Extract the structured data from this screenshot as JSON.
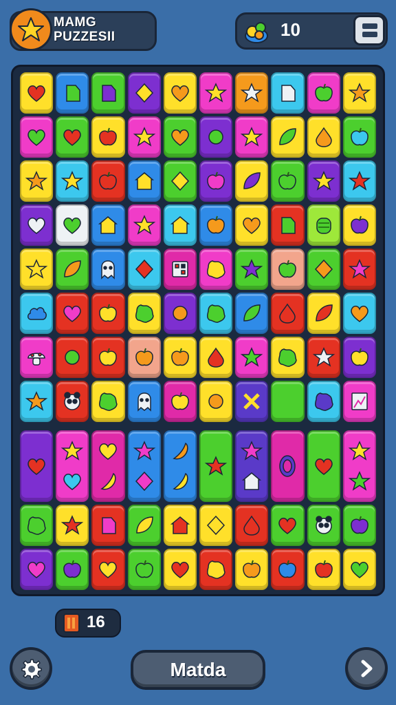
{
  "header": {
    "title": "MAMG PUZZESII",
    "score": "10",
    "title_icon": "star-icon",
    "score_icon": "gem-pile-icon",
    "menu_icon": "menu-icon"
  },
  "footer": {
    "moves": "16",
    "moves_icon": "door-icon",
    "settings_icon": "gear-icon",
    "match_label": "Matda",
    "next_icon": "chevron-right-icon"
  },
  "colors": {
    "background": "#3a6ea8",
    "board": "#1b2a40",
    "yellow": "#ffe02a",
    "blue": "#2f8be8",
    "green": "#4ccf2e",
    "purple": "#7d2fd0",
    "pink": "#f03cc8",
    "orange": "#f59a1c",
    "cyan": "#3cc8ee",
    "red": "#e43222",
    "lime": "#9ee83a",
    "magenta": "#e02aa8",
    "white": "#eef2f5",
    "peach": "#f2a58c",
    "violet": "#5a3ac8"
  },
  "board": {
    "rows": [
      [
        {
          "c": "yellow",
          "s": "heart",
          "f": "red"
        },
        {
          "c": "blue",
          "s": "tag",
          "f": "green"
        },
        {
          "c": "green",
          "s": "tag",
          "f": "purple"
        },
        {
          "c": "purple",
          "s": "diamond",
          "f": "yellow"
        },
        {
          "c": "yellow",
          "s": "heart",
          "f": "orange"
        },
        {
          "c": "pink",
          "s": "star",
          "f": "yellow"
        },
        {
          "c": "orange",
          "s": "star",
          "f": "white"
        },
        {
          "c": "cyan",
          "s": "tag",
          "f": "white"
        },
        {
          "c": "pink",
          "s": "apple",
          "f": "green"
        },
        {
          "c": "yellow",
          "s": "star",
          "f": "orange"
        }
      ],
      [
        {
          "c": "pink",
          "s": "heart",
          "f": "green"
        },
        {
          "c": "green",
          "s": "heart",
          "f": "red"
        },
        {
          "c": "yellow",
          "s": "apple",
          "f": "red"
        },
        {
          "c": "pink",
          "s": "star",
          "f": "yellow"
        },
        {
          "c": "green",
          "s": "heart",
          "f": "orange"
        },
        {
          "c": "purple",
          "s": "circle",
          "f": "green"
        },
        {
          "c": "pink",
          "s": "star",
          "f": "yellow"
        },
        {
          "c": "yellow",
          "s": "leaf",
          "f": "green"
        },
        {
          "c": "yellow",
          "s": "drop",
          "f": "orange"
        },
        {
          "c": "green",
          "s": "apple",
          "f": "cyan"
        }
      ],
      [
        {
          "c": "yellow",
          "s": "star",
          "f": "orange"
        },
        {
          "c": "cyan",
          "s": "star",
          "f": "yellow"
        },
        {
          "c": "red",
          "s": "apple",
          "f": "red"
        },
        {
          "c": "blue",
          "s": "house",
          "f": "yellow"
        },
        {
          "c": "green",
          "s": "diamond",
          "f": "yellow"
        },
        {
          "c": "purple",
          "s": "apple",
          "f": "pink"
        },
        {
          "c": "yellow",
          "s": "leaf",
          "f": "purple"
        },
        {
          "c": "green",
          "s": "apple",
          "f": "green"
        },
        {
          "c": "purple",
          "s": "star",
          "f": "yellow"
        },
        {
          "c": "cyan",
          "s": "star",
          "f": "red"
        }
      ],
      [
        {
          "c": "purple",
          "s": "heart",
          "f": "white"
        },
        {
          "c": "white",
          "s": "heart",
          "f": "green"
        },
        {
          "c": "blue",
          "s": "house",
          "f": "yellow"
        },
        {
          "c": "pink",
          "s": "star",
          "f": "yellow"
        },
        {
          "c": "cyan",
          "s": "house",
          "f": "yellow"
        },
        {
          "c": "blue",
          "s": "apple",
          "f": "orange"
        },
        {
          "c": "yellow",
          "s": "heart",
          "f": "orange"
        },
        {
          "c": "red",
          "s": "tag",
          "f": "green"
        },
        {
          "c": "lime",
          "s": "gate",
          "f": "green"
        },
        {
          "c": "yellow",
          "s": "apple",
          "f": "purple"
        }
      ],
      [
        {
          "c": "yellow",
          "s": "star",
          "f": "yellow"
        },
        {
          "c": "green",
          "s": "leaf",
          "f": "orange"
        },
        {
          "c": "blue",
          "s": "ghost",
          "f": "white"
        },
        {
          "c": "cyan",
          "s": "diamond",
          "f": "red"
        },
        {
          "c": "magenta",
          "s": "dice",
          "f": "white"
        },
        {
          "c": "pink",
          "s": "blob",
          "f": "yellow"
        },
        {
          "c": "green",
          "s": "star",
          "f": "purple"
        },
        {
          "c": "peach",
          "s": "apple",
          "f": "green"
        },
        {
          "c": "green",
          "s": "diamond",
          "f": "orange"
        },
        {
          "c": "red",
          "s": "star",
          "f": "pink"
        }
      ],
      [
        {
          "c": "cyan",
          "s": "cloud",
          "f": "blue"
        },
        {
          "c": "red",
          "s": "heart",
          "f": "pink"
        },
        {
          "c": "red",
          "s": "apple",
          "f": "yellow"
        },
        {
          "c": "yellow",
          "s": "blob",
          "f": "green"
        },
        {
          "c": "purple",
          "s": "circle",
          "f": "orange"
        },
        {
          "c": "cyan",
          "s": "blob",
          "f": "green"
        },
        {
          "c": "blue",
          "s": "leaf",
          "f": "green"
        },
        {
          "c": "red",
          "s": "drop",
          "f": "red"
        },
        {
          "c": "yellow",
          "s": "leaf",
          "f": "red"
        },
        {
          "c": "cyan",
          "s": "heart",
          "f": "orange"
        }
      ],
      [
        {
          "c": "pink",
          "s": "mushroom",
          "f": "white"
        },
        {
          "c": "red",
          "s": "circle",
          "f": "green"
        },
        {
          "c": "red",
          "s": "apple",
          "f": "yellow"
        },
        {
          "c": "peach",
          "s": "apple",
          "f": "orange"
        },
        {
          "c": "yellow",
          "s": "apple",
          "f": "orange"
        },
        {
          "c": "yellow",
          "s": "drop",
          "f": "red"
        },
        {
          "c": "pink",
          "s": "star",
          "f": "green"
        },
        {
          "c": "yellow",
          "s": "blob",
          "f": "green"
        },
        {
          "c": "red",
          "s": "star",
          "f": "white"
        },
        {
          "c": "purple",
          "s": "apple",
          "f": "yellow"
        }
      ],
      [
        {
          "c": "cyan",
          "s": "star",
          "f": "orange"
        },
        {
          "c": "red",
          "s": "panda",
          "f": "white"
        },
        {
          "c": "yellow",
          "s": "blob",
          "f": "green"
        },
        {
          "c": "blue",
          "s": "ghost",
          "f": "white"
        },
        {
          "c": "magenta",
          "s": "apple",
          "f": "yellow"
        },
        {
          "c": "yellow",
          "s": "circle",
          "f": "orange"
        },
        {
          "c": "violet",
          "s": "cross",
          "f": "yellow"
        },
        {
          "c": "green",
          "s": "none",
          "f": "green"
        },
        {
          "c": "cyan",
          "s": "blob",
          "f": "violet"
        },
        {
          "c": "pink",
          "s": "chart",
          "f": "white"
        }
      ],
      [
        {
          "c": "purple",
          "s": "heart",
          "f": "red",
          "tall": true
        },
        {
          "c": "pink",
          "s": "star",
          "f": "yellow",
          "s2": "heart",
          "f2": "cyan",
          "tall": true
        },
        {
          "c": "magenta",
          "s": "heart",
          "f": "yellow",
          "s2": "banana",
          "f2": "yellow",
          "tall": true
        },
        {
          "c": "blue",
          "s": "star",
          "f": "pink",
          "s2": "diamond",
          "f2": "pink",
          "tall": true
        },
        {
          "c": "blue",
          "s": "banana",
          "f": "orange",
          "s2": "banana",
          "f2": "yellow",
          "tall": true
        },
        {
          "c": "green",
          "s": "star",
          "f": "red",
          "tall": true
        },
        {
          "c": "violet",
          "s": "star",
          "f": "pink",
          "s2": "house",
          "f2": "white",
          "tall": true
        },
        {
          "c": "magenta",
          "s": "oval",
          "f": "violet",
          "tall": true
        },
        {
          "c": "green",
          "s": "heart",
          "f": "red",
          "s2": "none",
          "tall": true
        },
        {
          "c": "pink",
          "s": "star",
          "f": "yellow",
          "s2": "star",
          "f2": "green",
          "tall": true
        }
      ],
      [
        {
          "c": "green",
          "s": "blob",
          "f": "green"
        },
        {
          "c": "yellow",
          "s": "star",
          "f": "red"
        },
        {
          "c": "red",
          "s": "tag",
          "f": "pink"
        },
        {
          "c": "green",
          "s": "leaf",
          "f": "yellow"
        },
        {
          "c": "yellow",
          "s": "house",
          "f": "red"
        },
        {
          "c": "yellow",
          "s": "diamond",
          "f": "yellow"
        },
        {
          "c": "red",
          "s": "drop",
          "f": "red"
        },
        {
          "c": "green",
          "s": "heart",
          "f": "red"
        },
        {
          "c": "green",
          "s": "panda",
          "f": "white"
        },
        {
          "c": "green",
          "s": "apple",
          "f": "purple"
        }
      ],
      [
        {
          "c": "purple",
          "s": "heart",
          "f": "pink"
        },
        {
          "c": "green",
          "s": "apple",
          "f": "purple"
        },
        {
          "c": "red",
          "s": "heart",
          "f": "yellow"
        },
        {
          "c": "green",
          "s": "apple",
          "f": "green"
        },
        {
          "c": "yellow",
          "s": "heart",
          "f": "red"
        },
        {
          "c": "red",
          "s": "blob",
          "f": "yellow"
        },
        {
          "c": "yellow",
          "s": "apple",
          "f": "orange"
        },
        {
          "c": "red",
          "s": "apple",
          "f": "blue"
        },
        {
          "c": "yellow",
          "s": "apple",
          "f": "red"
        },
        {
          "c": "yellow",
          "s": "heart",
          "f": "green"
        }
      ]
    ]
  }
}
